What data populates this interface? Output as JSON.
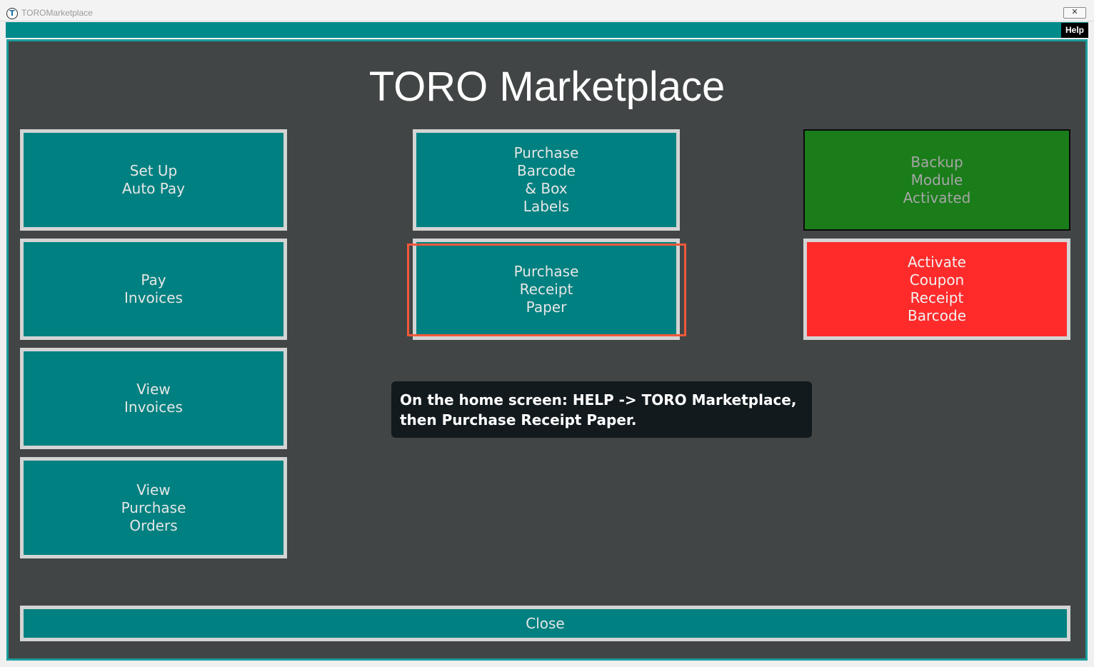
{
  "window": {
    "app_icon_glyph": "T",
    "title": "TOROMarketplace",
    "close_glyph": "✕",
    "help_label": "Help"
  },
  "page": {
    "title": "TORO Marketplace"
  },
  "tiles": {
    "setup_autopay": "Set Up\nAuto Pay",
    "pay_invoices": "Pay\nInvoices",
    "view_invoices": "View\nInvoices",
    "view_purchase_orders": "View\nPurchase\nOrders",
    "purchase_barcode_labels": "Purchase\nBarcode\n& Box\nLabels",
    "purchase_receipt_paper": "Purchase\nReceipt\nPaper",
    "backup_module": "Backup\nModule\nActivated",
    "activate_coupon": "Activate\nCoupon\nReceipt\nBarcode"
  },
  "tooltip": {
    "text": "On the home screen: HELP -> TORO Marketplace, then Purchase Receipt Paper."
  },
  "footer": {
    "close_label": "Close"
  },
  "colors": {
    "panel_background": "#424545",
    "tile_teal": "#008080",
    "tile_border": "#d4d4d4",
    "backup_green": "#1a7d1a",
    "coupon_red": "#ff2b2b",
    "highlight_orange": "#f4583a",
    "tooltip_background": "#121a1e",
    "strip_teal": "#008b8b"
  }
}
